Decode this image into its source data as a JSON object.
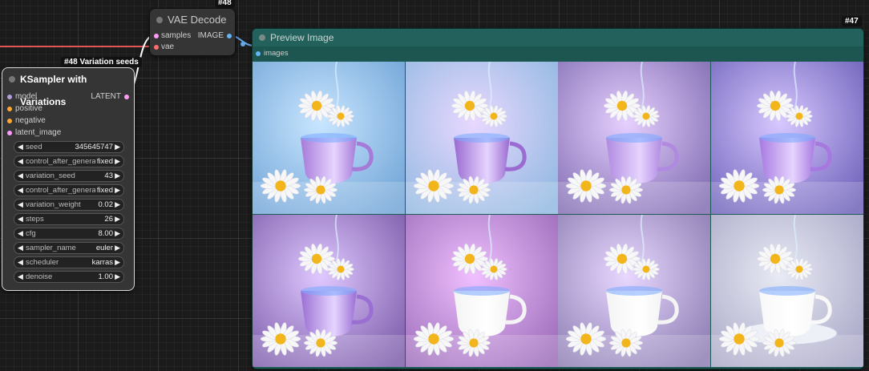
{
  "canvas": {
    "vae_decode": {
      "id": "#48",
      "title": "VAE Decode",
      "inputs": [
        "samples",
        "vae"
      ],
      "output": "IMAGE"
    },
    "ksampler": {
      "id": "#48 Variation seeds",
      "title": "KSampler with Variations",
      "inputs": [
        "model",
        "positive",
        "negative",
        "latent_image"
      ],
      "output": "LATENT",
      "widgets": [
        {
          "label": "seed",
          "value": "345645747"
        },
        {
          "label": "control_after_generate",
          "value": "fixed"
        },
        {
          "label": "variation_seed",
          "value": "43"
        },
        {
          "label": "control_after_generate",
          "value": "fixed"
        },
        {
          "label": "variation_weight",
          "value": "0.02"
        },
        {
          "label": "steps",
          "value": "26"
        },
        {
          "label": "cfg",
          "value": "8.00"
        },
        {
          "label": "sampler_name",
          "value": "euler"
        },
        {
          "label": "scheduler",
          "value": "karras"
        },
        {
          "label": "denoise",
          "value": "1.00"
        }
      ]
    },
    "preview_image": {
      "id": "#47",
      "title": "Preview Image",
      "input": "images",
      "images": [
        {
          "bg": "#6fa3d6",
          "cup": "#a57ad8",
          "accent": "#c9e6ff"
        },
        {
          "bg": "#8fb8e0",
          "cup": "#9a6bd0",
          "accent": "#e9d8ff"
        },
        {
          "bg": "#7e6ab0",
          "cup": "#b08ae0",
          "accent": "#e6d0ff"
        },
        {
          "bg": "#6b5fb8",
          "cup": "#a779e0",
          "accent": "#d8c8ff"
        },
        {
          "bg": "#7a5aa8",
          "cup": "#9a6fd4",
          "accent": "#e0c8ff"
        },
        {
          "bg": "#9a6ab8",
          "cup": "#f4f4f4",
          "accent": "#f0c0ff"
        },
        {
          "bg": "#8a7ab0",
          "cup": "#f4f4f4",
          "accent": "#e8d8ff"
        },
        {
          "bg": "#a8a6c6",
          "cup": "#f8f8f8",
          "accent": "#e8eaf4"
        }
      ]
    }
  }
}
